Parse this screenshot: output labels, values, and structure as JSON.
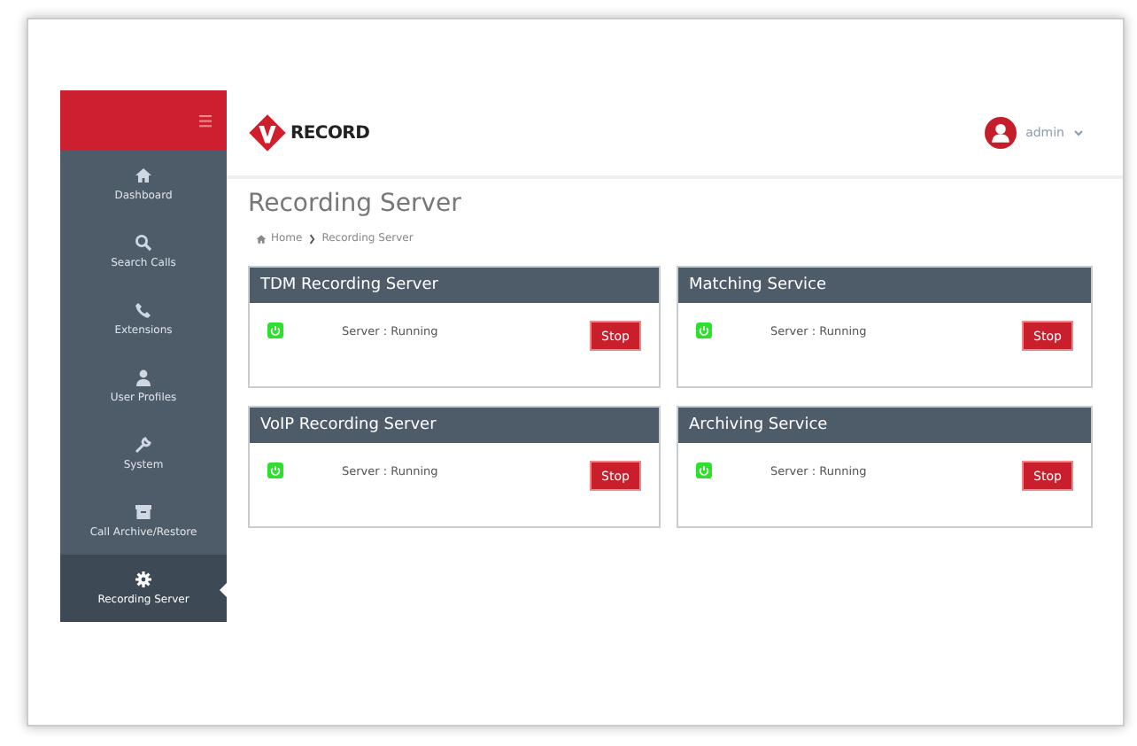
{
  "sidebar": {
    "items": [
      {
        "label": "Dashboard",
        "selected": false
      },
      {
        "label": "Search Calls",
        "selected": false
      },
      {
        "label": "Extensions",
        "selected": false
      },
      {
        "label": "User Profiles",
        "selected": false
      },
      {
        "label": "System",
        "selected": false
      },
      {
        "label": "Call Archive/Restore",
        "selected": false
      },
      {
        "label": "Recording Server",
        "selected": true
      }
    ]
  },
  "header": {
    "logo": "RECORD",
    "user": "admin"
  },
  "page": {
    "title": "Recording Server",
    "breadcrumb": [
      "Home",
      "Recording Server"
    ]
  },
  "panels": [
    {
      "title": "TDM Recording Server",
      "status": "Server : Running",
      "running": true,
      "button": "Stop"
    },
    {
      "title": "Matching Service",
      "status": "Server : Running",
      "running": true,
      "button": "Stop"
    },
    {
      "title": "VoIP Recording Server",
      "status": "Server : Running",
      "running": true,
      "button": "Stop"
    },
    {
      "title": "Archiving Service",
      "status": "Server : Running",
      "running": true,
      "button": "Stop"
    }
  ]
}
